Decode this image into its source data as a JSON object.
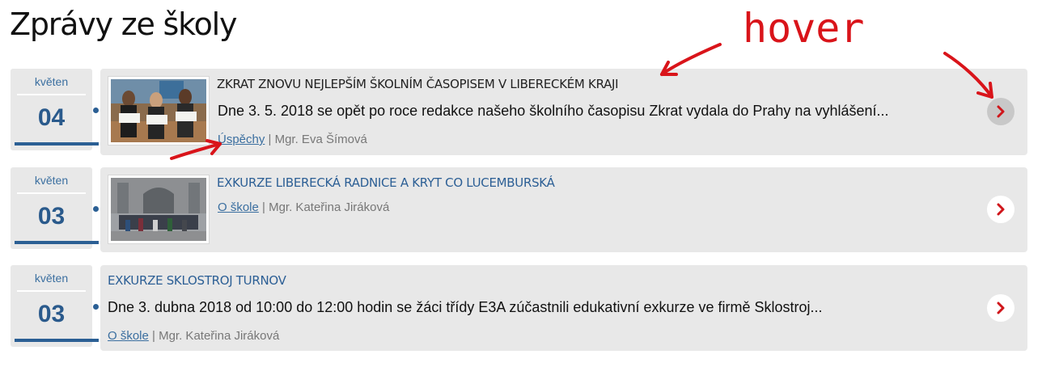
{
  "page": {
    "title": "Zprávy ze školy"
  },
  "colors": {
    "link": "#3b6fa0",
    "date_bar": "#2b5f94",
    "arrow": "#d0161b",
    "annotation": "#d9141a"
  },
  "news": [
    {
      "month": "květen",
      "day": "04",
      "title": "ZKRAT ZNOVU NEJLEPŠÍM ŠKOLNÍM ČASOPISEM V LIBERECKÉM KRAJI",
      "text": "Dne 3. 5. 2018 se opět po roce redakce našeho školního časopisu Zkrat vydala do Prahy na vyhlášení...",
      "category": "Úspěchy",
      "separator": " | ",
      "author": "Mgr. Eva Šímová",
      "thumbnail": "photo-students-with-diplomas",
      "state": "hover"
    },
    {
      "month": "květen",
      "day": "03",
      "title": "EXKURZE LIBERECKÁ RADNICE A KRYT CO LUCEMBURSKÁ",
      "text": "",
      "category": "O škole",
      "separator": " | ",
      "author": "Mgr. Kateřina Jiráková",
      "thumbnail": "photo-group-at-town-hall"
    },
    {
      "month": "květen",
      "day": "03",
      "title": "EXKURZE SKLOSTROJ TURNOV",
      "text": "Dne 3. dubna 2018 od 10:00 do 12:00 hodin se žáci třídy E3A zúčastnili edukativní exkurze ve firmě Sklostroj...",
      "category": "O škole",
      "separator": " | ",
      "author": "Mgr. Kateřina Jiráková",
      "thumbnail": ""
    }
  ],
  "annotation": {
    "label": "hover"
  }
}
